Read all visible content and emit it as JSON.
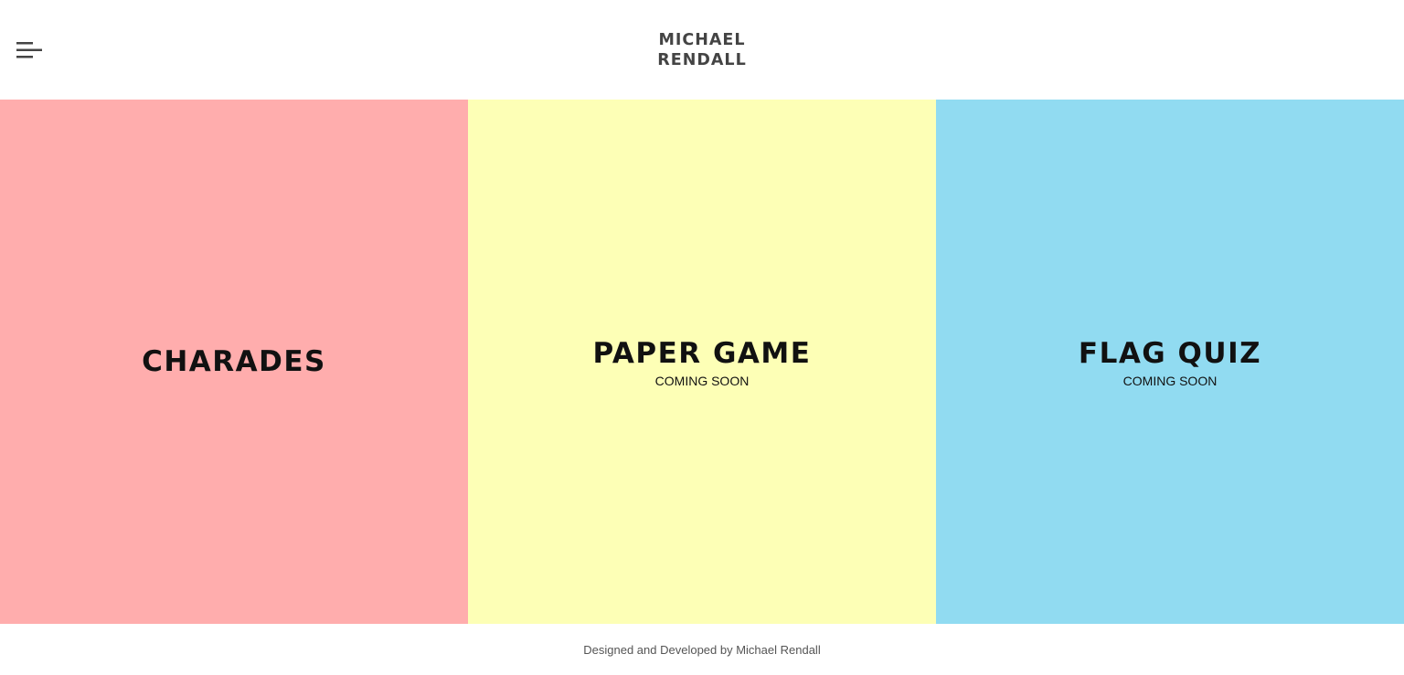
{
  "header": {
    "logo_line1": "MICHAEL",
    "logo_line2": "RENDALL",
    "menu_icon": "hamburger-menu-icon"
  },
  "panels": [
    {
      "title": "CHARADES",
      "subtitle": "",
      "color": "#ffadad"
    },
    {
      "title": "PAPER GAME",
      "subtitle": "COMING SOON",
      "color": "#fdffb6"
    },
    {
      "title": "FLAG QUIZ",
      "subtitle": "COMING SOON",
      "color": "#91dbf1"
    }
  ],
  "footer": {
    "credit": "Designed and Developed by Michael Rendall"
  }
}
